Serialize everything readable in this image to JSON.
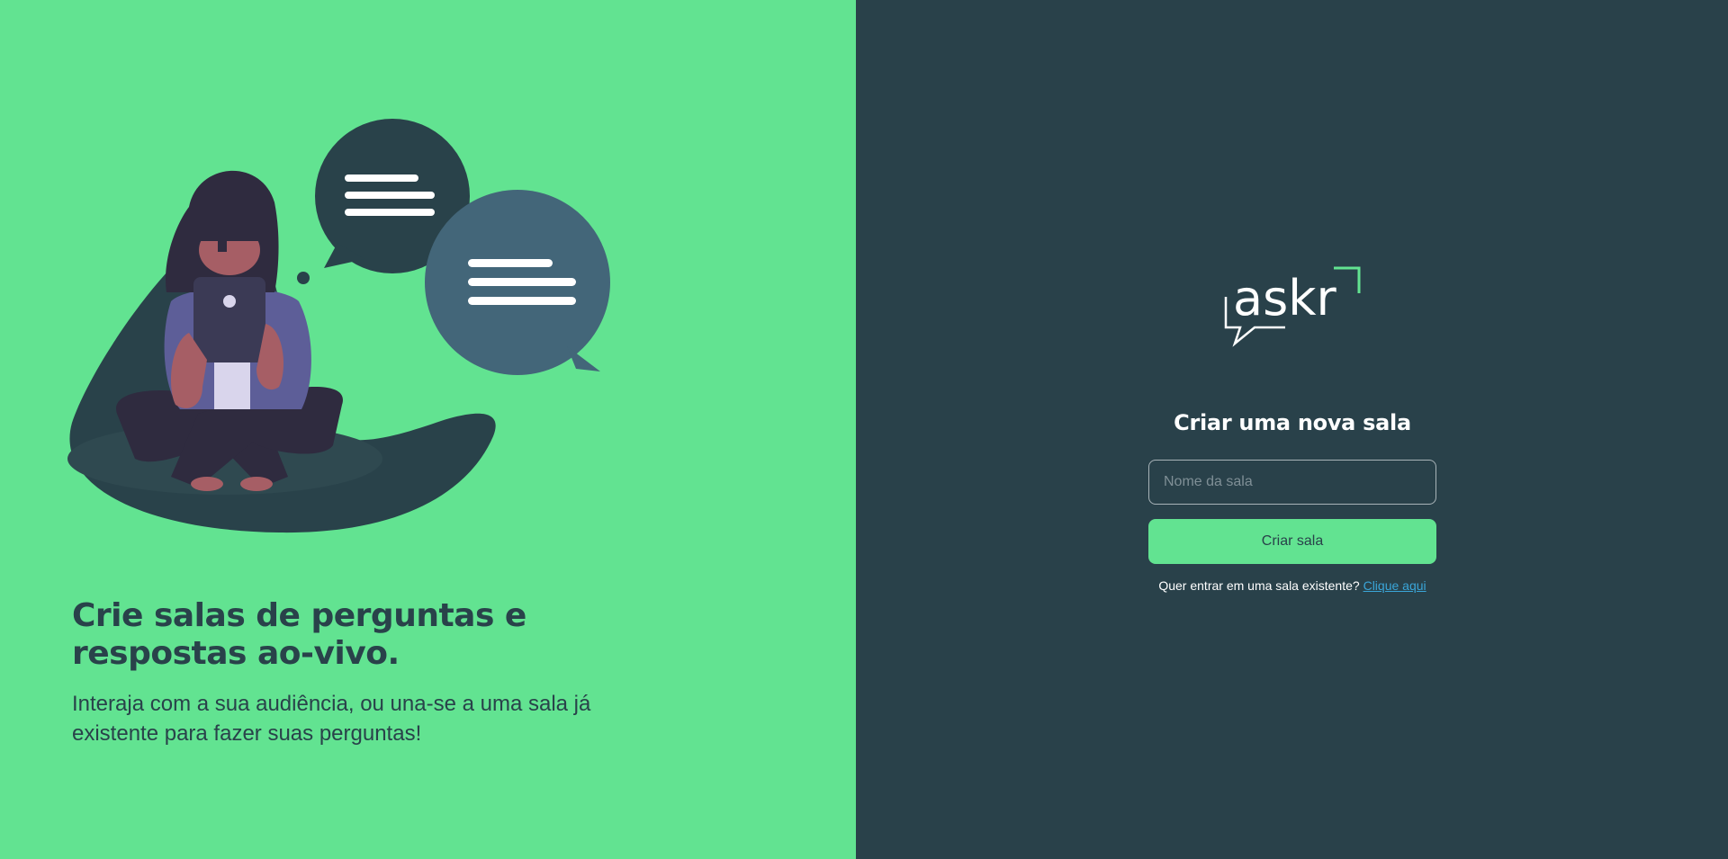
{
  "aside": {
    "title": "Crie salas de perguntas e respostas ao-vivo.",
    "subtitle": "Interaja com a sua audiência, ou una-se a uma sala já existente para fazer suas perguntas!",
    "illustration_icon": "woman-chat-illustration"
  },
  "main": {
    "logo_text": "askr",
    "logo_icon": "askr-logo",
    "heading": "Criar uma nova sala",
    "room_input": {
      "value": "",
      "placeholder": "Nome da sala"
    },
    "create_button_label": "Criar sala",
    "join_prompt": "Quer entrar em uma sala existente?",
    "join_link": "Clique aqui"
  },
  "colors": {
    "aside_bg": "#62e391",
    "main_bg": "#29414a",
    "accent": "#62e391",
    "link": "#3aa5d8",
    "dark_text": "#29424a"
  }
}
